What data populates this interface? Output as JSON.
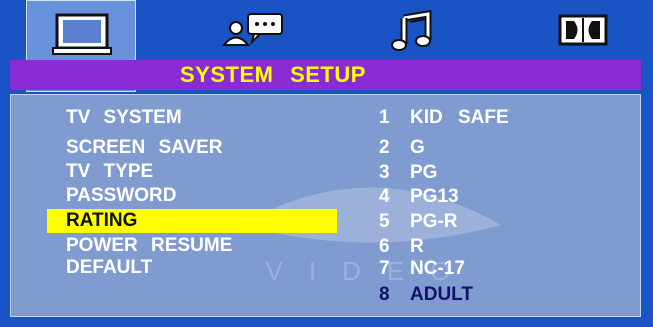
{
  "tabs": [
    {
      "name": "system",
      "icon": "monitor-icon",
      "active": true
    },
    {
      "name": "language",
      "icon": "speaker-chat-icon",
      "active": false
    },
    {
      "name": "audio",
      "icon": "music-note-icon",
      "active": false
    },
    {
      "name": "dolby",
      "icon": "dolby-digital-icon",
      "active": false
    }
  ],
  "title": "SYSTEM SETUP",
  "menu": [
    {
      "label": "TV SYSTEM"
    },
    {
      "label": "SCREEN SAVER"
    },
    {
      "label": "TV TYPE"
    },
    {
      "label": "PASSWORD"
    },
    {
      "label": "RATING",
      "selected": true
    },
    {
      "label": "POWER RESUME"
    },
    {
      "label": "DEFAULT"
    }
  ],
  "options": [
    {
      "num": "1",
      "label": "KID SAFE"
    },
    {
      "num": "2",
      "label": "G"
    },
    {
      "num": "3",
      "label": "PG"
    },
    {
      "num": "4",
      "label": "PG13"
    },
    {
      "num": "5",
      "label": "PG-R"
    },
    {
      "num": "6",
      "label": "R"
    },
    {
      "num": "7",
      "label": "NC-17"
    },
    {
      "num": "8",
      "label": "ADULT",
      "selected": true
    }
  ],
  "watermark": "VIDEO",
  "colors": {
    "frame": "#1a53c4",
    "title_bar": "#8a2bd6",
    "title_text": "#ffff00",
    "panel": "#7f9bd0",
    "highlight": "#ffff00",
    "selected_option": "#11116a"
  }
}
